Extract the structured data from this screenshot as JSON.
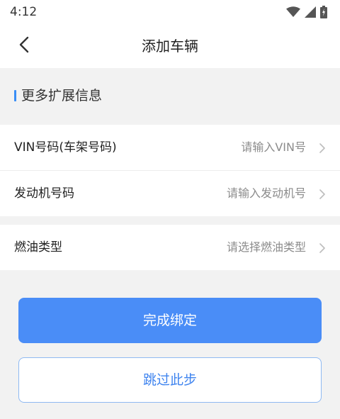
{
  "status_bar": {
    "time": "4:12",
    "icons": [
      "wifi-icon",
      "signal-icon",
      "battery-icon"
    ]
  },
  "header": {
    "back_icon": "chevron-left-icon",
    "title": "添加车辆"
  },
  "section": {
    "title": "更多扩展信息"
  },
  "form": {
    "rows": [
      {
        "label": "VIN号码(车架号码)",
        "placeholder": "请输入VIN号"
      },
      {
        "label": "发动机号码",
        "placeholder": "请输入发动机号"
      },
      {
        "label": "燃油类型",
        "placeholder": "请选择燃油类型"
      }
    ]
  },
  "actions": {
    "primary_label": "完成绑定",
    "secondary_label": "跳过此步"
  },
  "colors": {
    "accent": "#4a8df7",
    "background": "#f2f2f2",
    "secondary_border": "#8fb9f2"
  }
}
